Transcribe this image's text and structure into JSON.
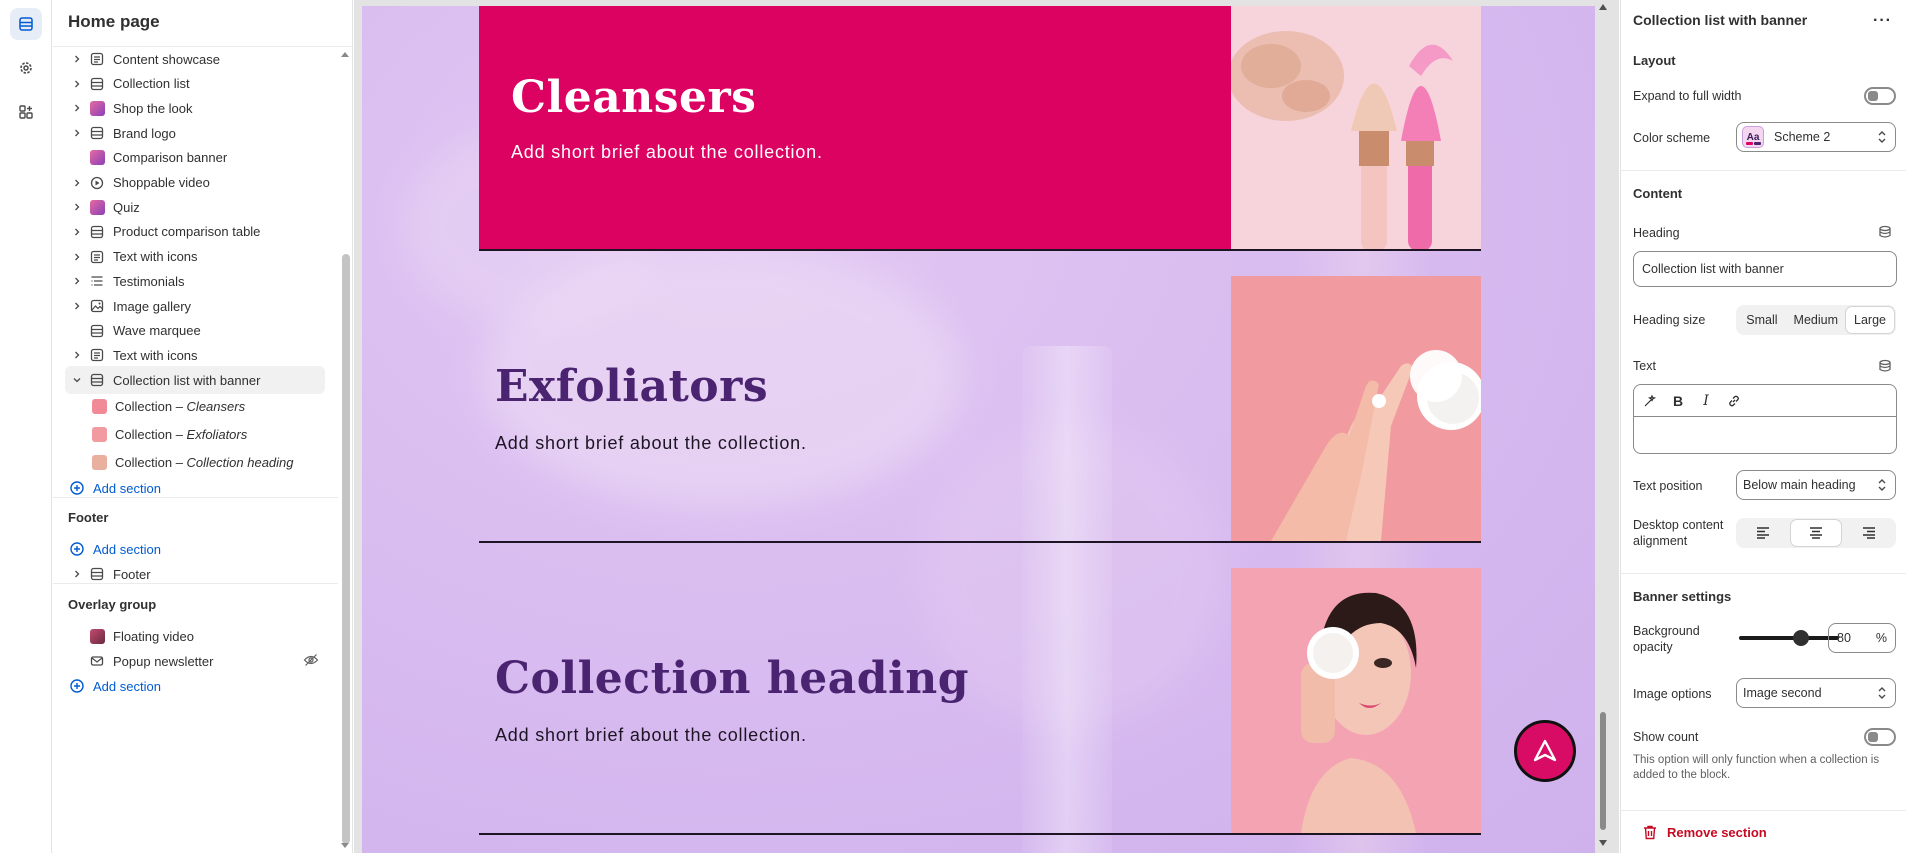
{
  "rail": {
    "items": [
      "sections-icon",
      "settings-icon",
      "apps-icon"
    ]
  },
  "sidebar": {
    "title": "Home page",
    "sections": [
      {
        "label": "Content showcase",
        "icon": "text-block-icon",
        "chevron": true
      },
      {
        "label": "Collection list",
        "icon": "layout-icon",
        "chevron": true
      },
      {
        "label": "Shop the look",
        "icon": "image-thumb",
        "chevron": true
      },
      {
        "label": "Brand logo",
        "icon": "layout-icon",
        "chevron": true
      },
      {
        "label": "Comparison banner",
        "icon": "image-thumb",
        "chevron": false
      },
      {
        "label": "Shoppable video",
        "icon": "play-icon",
        "chevron": true
      },
      {
        "label": "Quiz",
        "icon": "image-thumb",
        "chevron": true
      },
      {
        "label": "Product comparison table",
        "icon": "layout-icon",
        "chevron": true
      },
      {
        "label": "Text with icons",
        "icon": "text-block-icon",
        "chevron": true
      },
      {
        "label": "Testimonials",
        "icon": "list-icon",
        "chevron": true
      },
      {
        "label": "Image gallery",
        "icon": "gallery-icon",
        "chevron": true
      },
      {
        "label": "Wave marquee",
        "icon": "layout-icon",
        "chevron": false
      },
      {
        "label": "Text with icons",
        "icon": "text-block-icon",
        "chevron": true
      },
      {
        "label": "Collection list with banner",
        "icon": "layout-icon",
        "chevron": true,
        "expanded": true
      }
    ],
    "blocks": [
      {
        "prefix": "Collection – ",
        "name": "Cleansers"
      },
      {
        "prefix": "Collection – ",
        "name": "Exfoliators"
      },
      {
        "prefix": "Collection – ",
        "name": "Collection heading"
      }
    ],
    "add_section": "Add section",
    "footer_group": {
      "title": "Footer",
      "add": "Add section",
      "item": "Footer"
    },
    "overlay_group": {
      "title": "Overlay group",
      "items": [
        "Floating video",
        "Popup newsletter"
      ],
      "add": "Add section"
    }
  },
  "preview": {
    "collections": [
      {
        "heading": "Cleansers",
        "brief": "Add short brief about the collection.",
        "banner_color": "#dc0262",
        "text_color": "#ffffff"
      },
      {
        "heading": "Exfoliators",
        "brief": "Add short brief about the collection.",
        "banner_color": "transparent",
        "text_color": "#4a2470"
      },
      {
        "heading": "Collection heading",
        "brief": "Add short brief about the collection.",
        "banner_color": "transparent",
        "text_color": "#4a2470"
      }
    ],
    "background_color": "#d9bcf0",
    "accent": "#d80c64"
  },
  "panel": {
    "title": "Collection list with banner",
    "layout": {
      "title": "Layout",
      "expand_label": "Expand to full width",
      "color_scheme_label": "Color scheme",
      "color_scheme_value": "Scheme 2",
      "swatch_text": "Aa"
    },
    "content": {
      "title": "Content",
      "heading_label": "Heading",
      "heading_value": "Collection list with banner",
      "heading_size_label": "Heading size",
      "heading_sizes": [
        "Small",
        "Medium",
        "Large"
      ],
      "heading_size_selected": "Large",
      "text_label": "Text",
      "text_position_label": "Text position",
      "text_position_value": "Below main heading",
      "alignment_label_1": "Desktop content",
      "alignment_label_2": "alignment",
      "alignment_selected": "center"
    },
    "banner": {
      "title": "Banner settings",
      "opacity_label_1": "Background",
      "opacity_label_2": "opacity",
      "opacity_value": "80",
      "opacity_unit": "%",
      "opacity_fraction": 0.8,
      "image_options_label": "Image options",
      "image_options_value": "Image second",
      "show_count_label": "Show count",
      "show_count_hint": "This option will only function when a collection is added to the block."
    },
    "remove_label": "Remove section"
  }
}
